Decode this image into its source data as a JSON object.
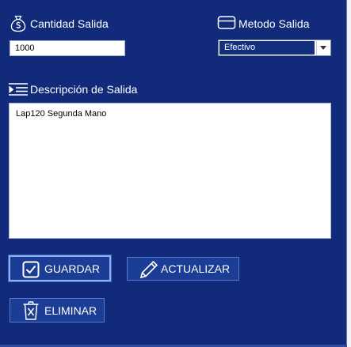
{
  "cantidad": {
    "label": "Cantidad Salida",
    "value": "1000",
    "icon": "money-bag-icon"
  },
  "metodo": {
    "label": "Metodo Salida",
    "selected": "Efectivo",
    "icon": "credit-card-icon"
  },
  "descripcion": {
    "label": "Descripción de Salida",
    "value": "Lap120 Segunda Mano",
    "icon": "text-indent-icon"
  },
  "buttons": {
    "guardar": {
      "label": "GUARDAR",
      "icon": "checkbox-check-icon"
    },
    "actualizar": {
      "label": "ACTUALIZAR",
      "icon": "pencil-icon"
    },
    "eliminar": {
      "label": "ELIMINAR",
      "icon": "trash-icon"
    }
  },
  "colors": {
    "panel_bg": "#112b7a",
    "button_bg": "#1b3d95",
    "select_highlight": "#13307e"
  }
}
